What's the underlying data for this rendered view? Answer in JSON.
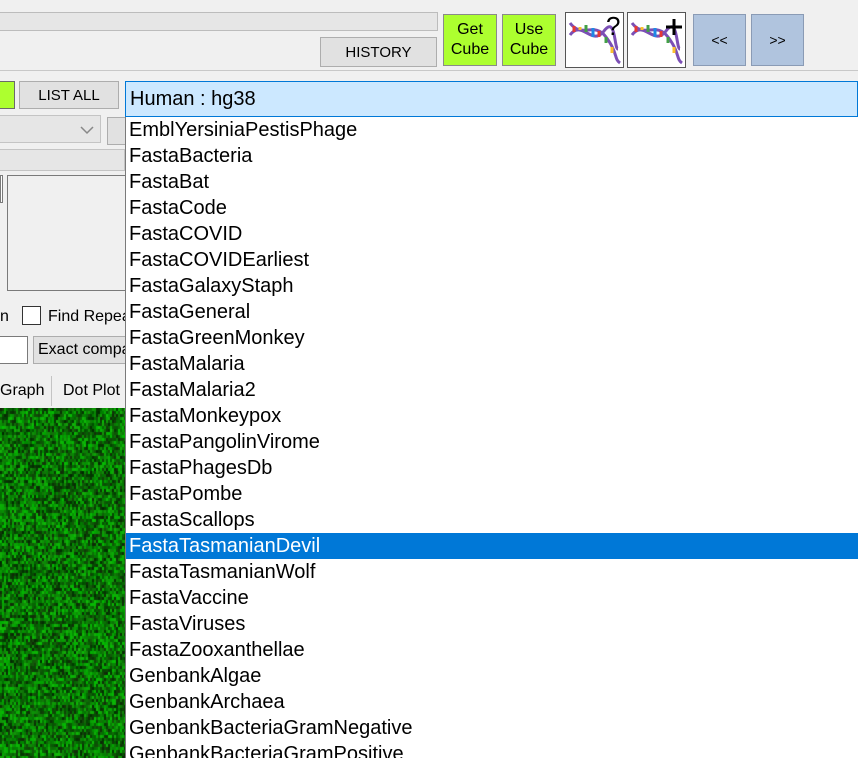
{
  "toolbar": {
    "history_label": "HISTORY",
    "get_cube_line1": "Get",
    "get_cube_line2": "Cube",
    "use_cube_line1": "Use",
    "use_cube_line2": "Cube",
    "dna_help_icon": "dna-question-icon",
    "dna_add_icon": "dna-plus-icon",
    "prev_label": "<<",
    "next_label": ">>"
  },
  "list_all_label": "LIST ALL",
  "genome_select": {
    "value": "Human : hg38"
  },
  "options": {
    "find_repeat_label": "Find Repea",
    "find_repeat_prefix": "n",
    "exact_compare_label": "Exact compa"
  },
  "tabs": {
    "graph_label": "Graph",
    "dot_plot_label": "Dot Plot"
  },
  "dropdown": {
    "items": [
      "EmblYersiniaPestisPhage",
      "FastaBacteria",
      "FastaBat",
      "FastaCode",
      "FastaCOVID",
      "FastaCOVIDEarliest",
      "FastaGalaxyStaph",
      "FastaGeneral",
      "FastaGreenMonkey",
      "FastaMalaria",
      "FastaMalaria2",
      "FastaMonkeypox",
      "FastaPangolinVirome",
      "FastaPhagesDb",
      "FastaPombe",
      "FastaScallops",
      "FastaTasmanianDevil",
      "FastaTasmanianWolf",
      "FastaVaccine",
      "FastaViruses",
      "FastaZooxanthellae",
      "GenbankAlgae",
      "GenbankArchaea",
      "GenbankBacteriaGramNegative",
      "GenbankBacteriaGramPositive"
    ],
    "selected_index": 16
  },
  "colors": {
    "accent_green": "#adff2f",
    "nav_blue": "#b0c4de",
    "selection": "#0078d7",
    "combo_bg": "#cce8ff",
    "heatmap_green": "#2e9a2e"
  }
}
